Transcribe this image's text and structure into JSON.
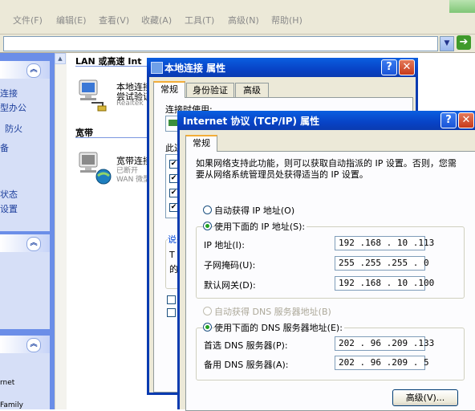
{
  "menubar": {
    "items": [
      "文件(F)",
      "编辑(E)",
      "查看(V)",
      "收藏(A)",
      "工具(T)",
      "高级(N)",
      "帮助(H)"
    ]
  },
  "toolbar": {
    "go_icon": "go-arrow-icon"
  },
  "taskpane": {
    "links": [
      "连接",
      "型办公",
      "防火",
      "备",
      "状态",
      "设置"
    ],
    "bottom_texts": [
      "rnet",
      "Family"
    ]
  },
  "content": {
    "section_lan": "LAN 或高速 Int",
    "lan_conn": {
      "name": "本地连接",
      "line2": "尝试验证",
      "line3": "Realtek"
    },
    "section_broadband": "宽带",
    "broadband_conn": {
      "name": "宽带连接",
      "line2": "已断开",
      "line3": "WAN 微型"
    }
  },
  "win1": {
    "title": "本地连接 属性",
    "tabs": [
      "常规",
      "身份验证",
      "高级"
    ],
    "connect_label": "连接时使用:",
    "items_label": "此连",
    "desc_label": "说",
    "desc_partial": [
      "T",
      "的"
    ]
  },
  "win2": {
    "title": "Internet 协议 (TCP/IP) 属性",
    "tabs": [
      "常规"
    ],
    "info": "如果网络支持此功能，则可以获取自动指派的 IP 设置。否则，您需要从网络系统管理员处获得适当的 IP 设置。",
    "radio_auto_ip": "自动获得 IP 地址(O)",
    "radio_manual_ip": "使用下面的 IP 地址(S):",
    "ip_label": "IP 地址(I):",
    "ip_value": "192 .168 . 10 .113",
    "mask_label": "子网掩码(U):",
    "mask_value": "255 .255 .255 . 0",
    "gateway_label": "默认网关(D):",
    "gateway_value": "192 .168 . 10 .100",
    "radio_auto_dns": "自动获得 DNS 服务器地址(B)",
    "radio_manual_dns": "使用下面的 DNS 服务器地址(E):",
    "dns1_label": "首选 DNS 服务器(P):",
    "dns1_value": "202 . 96 .209 .133",
    "dns2_label": "备用 DNS 服务器(A):",
    "dns2_value": "202 . 96 .209 . 5",
    "advanced_button": "高级(V)..."
  },
  "colors": {
    "xp_title_blue": "#0843c6",
    "dialog_bg": "#ece9d8",
    "taskpane_blue": "#6b8ee8"
  }
}
